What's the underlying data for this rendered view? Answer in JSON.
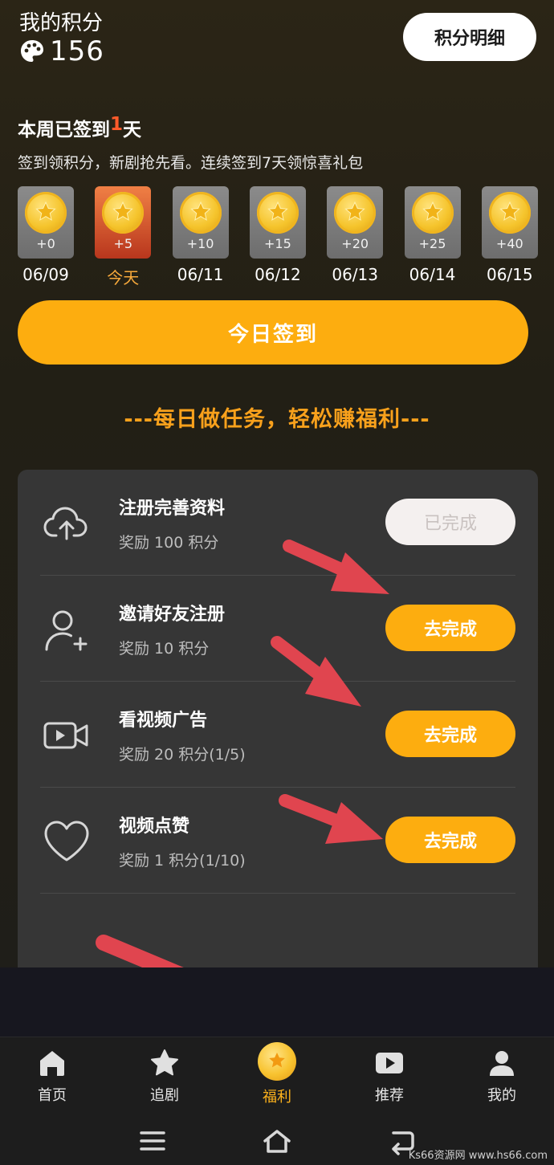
{
  "header": {
    "title": "我的积分",
    "points": "156",
    "detail_button": "积分明细"
  },
  "checkin": {
    "title_prefix": "本周已签到",
    "title_count": "1",
    "title_suffix": "天",
    "subtitle": "签到领积分，新剧抢先看。连续签到7天领惊喜礼包",
    "days": [
      {
        "bonus": "+0",
        "date": "06/09"
      },
      {
        "bonus": "+5",
        "date": "今天"
      },
      {
        "bonus": "+10",
        "date": "06/11"
      },
      {
        "bonus": "+15",
        "date": "06/12"
      },
      {
        "bonus": "+20",
        "date": "06/13"
      },
      {
        "bonus": "+25",
        "date": "06/14"
      },
      {
        "bonus": "+40",
        "date": "06/15"
      }
    ],
    "button": "今日签到"
  },
  "tasks_heading": "---每日做任务，轻松赚福利---",
  "tasks": [
    {
      "name": "注册完善资料",
      "reward": "奖励 100 积分",
      "button": "已完成",
      "icon": "cloud-upload-icon"
    },
    {
      "name": "邀请好友注册",
      "reward": "奖励 10 积分",
      "button": "去完成",
      "icon": "add-user-icon"
    },
    {
      "name": "看视频广告",
      "reward": "奖励 20 积分(1/5)",
      "button": "去完成",
      "icon": "video-camera-icon"
    },
    {
      "name": "视频点赞",
      "reward": "奖励 1 积分(1/10)",
      "button": "去完成",
      "icon": "heart-icon"
    }
  ],
  "nav": [
    {
      "label": "首页",
      "icon": "home-icon"
    },
    {
      "label": "追剧",
      "icon": "star-icon"
    },
    {
      "label": "福利",
      "icon": "coin-icon"
    },
    {
      "label": "推荐",
      "icon": "play-icon"
    },
    {
      "label": "我的",
      "icon": "user-icon"
    }
  ],
  "watermark": "Ks66资源网 www.hs66.com",
  "colors": {
    "accent": "#fdad0f",
    "today": "#f7a93b",
    "highlight": "#ff5a2a",
    "arrow": "#e0454f"
  }
}
